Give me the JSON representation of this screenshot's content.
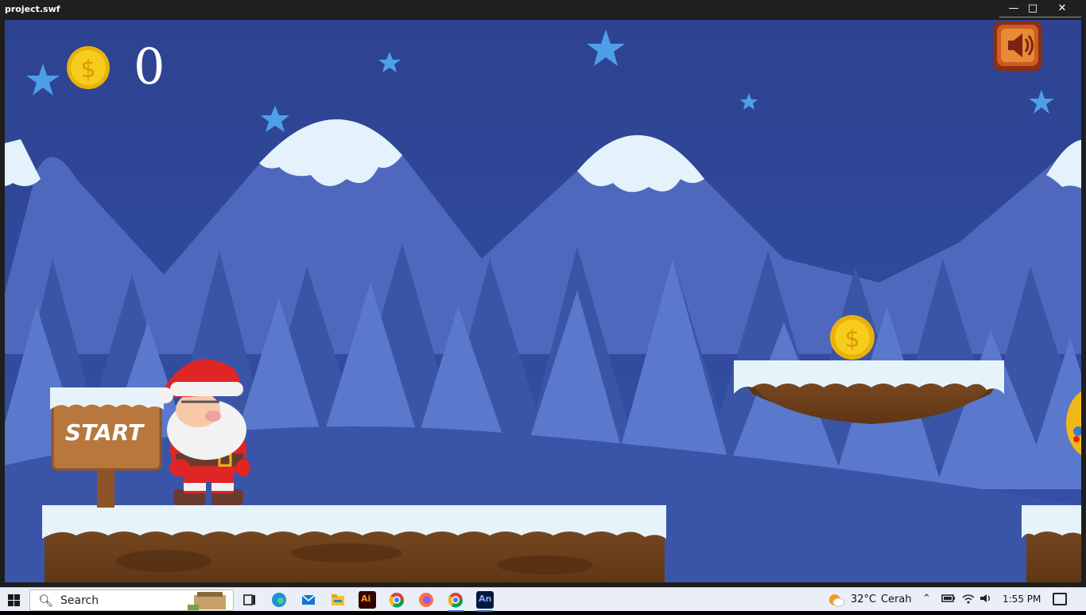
{
  "window": {
    "title": "project.swf",
    "controls": {
      "minimize": "—",
      "maximize": "□",
      "close": "✕"
    }
  },
  "game": {
    "coin_count": "0",
    "sign_text": "START",
    "icons": {
      "coin": "coin-icon",
      "star": "star-icon",
      "sound": "sound-icon",
      "player": "santa-character",
      "enemy": "enemy-character"
    },
    "colors": {
      "sky": "#2e4490",
      "mountain": "#4a63b8",
      "snow": "#e6f3fb",
      "star": "#4f9fe8",
      "coin": "#f4c20d",
      "dirt": "#8a5a2e",
      "sign_wood": "#b8773d"
    }
  },
  "taskbar": {
    "search_placeholder": "Search",
    "weather_temp": "32°C",
    "weather_condition": "Cerah",
    "time": "1:55 PM",
    "apps": [
      "edge",
      "mail",
      "explorer",
      "illustrator",
      "chrome",
      "firefox",
      "chrome-alt",
      "animate"
    ],
    "app_labels": {
      "illustrator": "Ai",
      "animate": "An"
    }
  }
}
